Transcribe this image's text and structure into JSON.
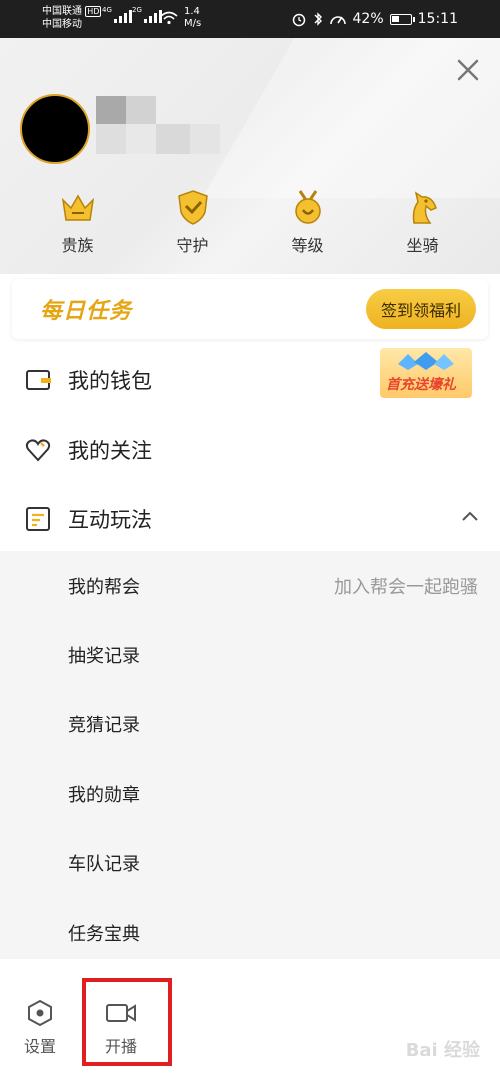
{
  "status_bar": {
    "carrier1": "中国联通",
    "carrier1_tag": "HD",
    "carrier2": "中国移动",
    "net1": "4G",
    "net2": "2G",
    "speed_value": "1.4",
    "speed_unit": "M/s",
    "battery": "42%",
    "battery_level": 0.42,
    "time": "15:11"
  },
  "header": {
    "close_icon": "close-icon",
    "avatar_color": "#000000",
    "badges": [
      {
        "label": "贵族",
        "icon": "crown-icon"
      },
      {
        "label": "守护",
        "icon": "shield-icon"
      },
      {
        "label": "等级",
        "icon": "level-medal-icon"
      },
      {
        "label": "坐骑",
        "icon": "horse-icon"
      }
    ],
    "accent_color": "#f2b21e"
  },
  "daily_task": {
    "title": "每日任务",
    "button": "签到领福利"
  },
  "menu": [
    {
      "label": "我的钱包",
      "icon": "wallet-icon",
      "promo": "首充送壕礼"
    },
    {
      "label": "我的关注",
      "icon": "heart-icon"
    },
    {
      "label": "互动玩法",
      "icon": "list-icon",
      "expanded": true
    }
  ],
  "submenu": [
    {
      "label": "我的帮会",
      "hint": "加入帮会一起跑骚"
    },
    {
      "label": "抽奖记录"
    },
    {
      "label": "竞猜记录"
    },
    {
      "label": "我的勋章"
    },
    {
      "label": "车队记录"
    },
    {
      "label": "任务宝典"
    }
  ],
  "bottom_bar": {
    "tabs": [
      {
        "label": "设置",
        "icon": "settings-hexagon-icon"
      },
      {
        "label": "开播",
        "icon": "video-camera-icon"
      }
    ],
    "highlight_color": "#e02020"
  },
  "watermark": "Bai 经验"
}
